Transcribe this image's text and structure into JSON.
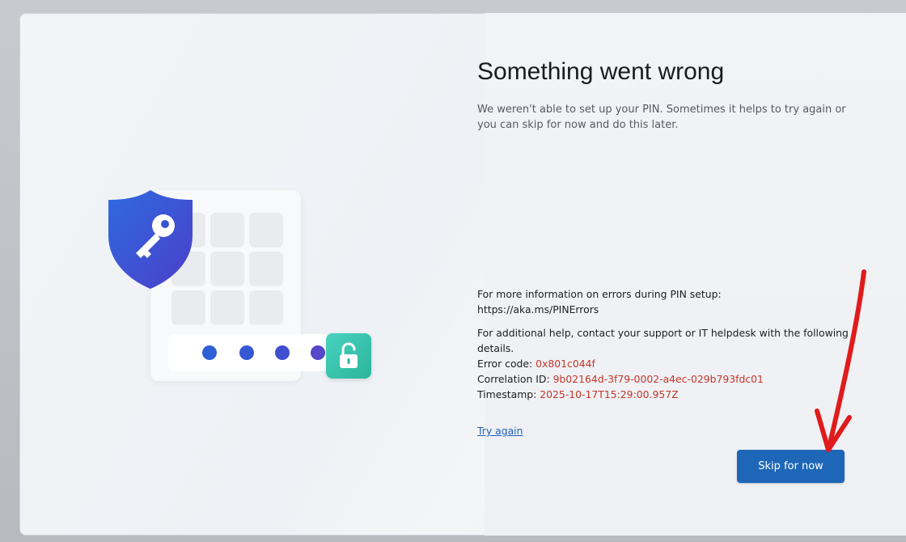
{
  "dialog": {
    "title": "Something went wrong",
    "description": "We weren't able to set up your PIN. Sometimes it helps to try again or you can skip for now and do this later.",
    "info": {
      "more_info_text": "For more information on errors during PIN setup:",
      "more_info_link": "https://aka.ms/PINErrors",
      "help_text": "For additional help, contact your support or IT helpdesk with the following details.",
      "error_code_label": "Error code: ",
      "error_code_value": "0x801c044f",
      "correlation_label": "Correlation ID: ",
      "correlation_value": "9b02164d-3f79-0002-a4ec-029b793fdc01",
      "timestamp_label": "Timestamp: ",
      "timestamp_value": "2025-10-17T15:29:00.957Z"
    },
    "try_again_label": "Try again",
    "skip_label": "Skip for now"
  },
  "colors": {
    "accent": "#1e67b8",
    "error": "#c4362b",
    "shield": "#3b4fd1",
    "lock_tile": "#2bb59d",
    "annotation_arrow": "#e01b1b"
  },
  "icons": {
    "shield": "shield-key-icon",
    "lock": "unlock-icon",
    "arrow": "red-arrow-annotation"
  }
}
